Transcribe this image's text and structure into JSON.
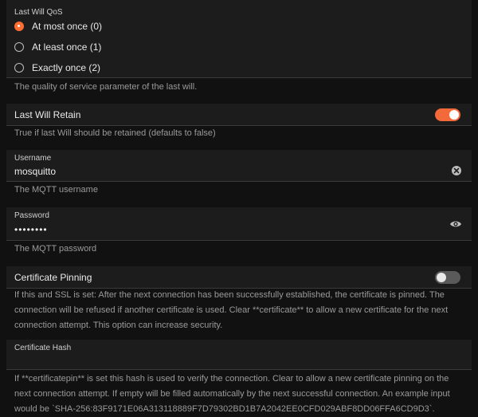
{
  "qos": {
    "title": "Last Will QoS",
    "options": [
      {
        "label": "At most once (0)",
        "checked": true
      },
      {
        "label": "At least once (1)",
        "checked": false
      },
      {
        "label": "Exactly once (2)",
        "checked": false
      }
    ],
    "help": "The quality of service parameter of the last will."
  },
  "retain": {
    "title": "Last Will Retain",
    "enabled": true,
    "help": "True if last Will should be retained (defaults to false)"
  },
  "username": {
    "label": "Username",
    "value": "mosquitto",
    "help": "The MQTT username",
    "icon": "clear-icon"
  },
  "password": {
    "label": "Password",
    "value": "••••••••",
    "help": "The MQTT password",
    "icon": "eye-icon"
  },
  "pinning": {
    "title": "Certificate Pinning",
    "enabled": false,
    "help": "If this and SSL is set: After the next connection has been successfully established, the certificate is pinned. The connection will be refused if another certificate is used. Clear **certificate** to allow a new certificate for the next connection attempt. This option can increase security."
  },
  "cert_hash": {
    "label": "Certificate Hash",
    "value": "",
    "help": "If **certificatepin** is set this hash is used to verify the connection. Clear to allow a new certificate pinning on the next connection attempt. If empty will be filled automatically by the next successful connection. An example input would be `SHA-256:83F9171E06A313118889F7D79302BD1B7A2042EE0CFD029ABF8DD06FFA6CD9D3`."
  },
  "colors": {
    "accent": "#f26a3a",
    "background": "#111111",
    "card": "#1c1c1c"
  }
}
